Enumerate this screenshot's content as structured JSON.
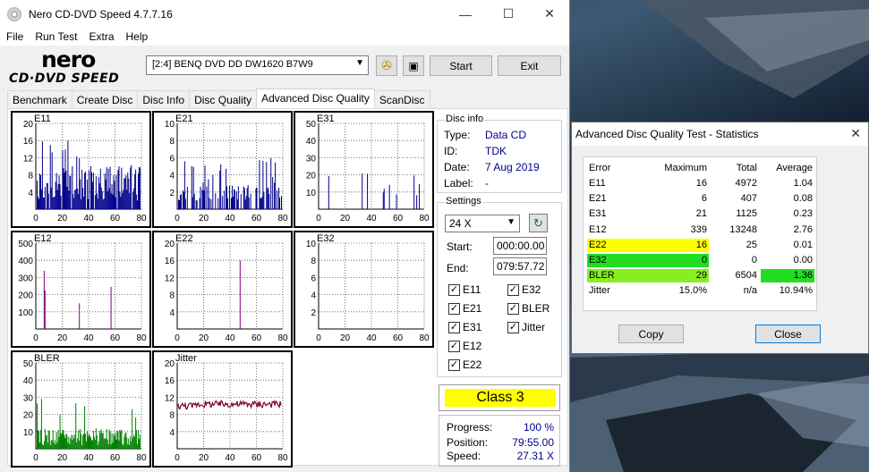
{
  "window": {
    "title": "Nero CD-DVD Speed 4.7.7.16",
    "minimize": "—",
    "maximize": "☐",
    "close": "✕"
  },
  "menu": [
    "File",
    "Run Test",
    "Extra",
    "Help"
  ],
  "logo": {
    "top": "nero",
    "bottom": "CD·DVD SPEED"
  },
  "toolbar": {
    "drive": "[2:4]   BENQ DVD DD DW1620 B7W9",
    "start": "Start",
    "exit": "Exit"
  },
  "tabs": [
    "Benchmark",
    "Create Disc",
    "Disc Info",
    "Disc Quality",
    "Advanced Disc Quality",
    "ScanDisc"
  ],
  "active_tab": 4,
  "graphs": [
    {
      "name": "E11",
      "yticks": [
        "20",
        "16",
        "12",
        "8",
        "4"
      ],
      "ymax": 20,
      "color": "#00008b",
      "kind": "bar"
    },
    {
      "name": "E21",
      "yticks": [
        "10",
        "8",
        "6",
        "4",
        "2"
      ],
      "ymax": 10,
      "color": "#00008b",
      "kind": "bar"
    },
    {
      "name": "E31",
      "yticks": [
        "50",
        "40",
        "30",
        "20",
        "10"
      ],
      "ymax": 50,
      "color": "#00008b",
      "kind": "bar"
    },
    {
      "name": "E12",
      "yticks": [
        "500",
        "400",
        "300",
        "200",
        "100"
      ],
      "ymax": 500,
      "color": "#800080",
      "kind": "bar"
    },
    {
      "name": "E22",
      "yticks": [
        "20",
        "16",
        "12",
        "8",
        "4"
      ],
      "ymax": 20,
      "color": "#800080",
      "kind": "bar"
    },
    {
      "name": "E32",
      "yticks": [
        "10",
        "8",
        "6",
        "4",
        "2"
      ],
      "ymax": 10,
      "color": "#800080",
      "kind": "bar"
    },
    {
      "name": "BLER",
      "yticks": [
        "50",
        "40",
        "30",
        "20",
        "10"
      ],
      "ymax": 50,
      "color": "#008000",
      "kind": "bar"
    },
    {
      "name": "Jitter",
      "yticks": [
        "20",
        "16",
        "12",
        "8",
        "4"
      ],
      "ymax": 20,
      "color": "#800020",
      "kind": "line"
    }
  ],
  "xticks": [
    "0",
    "20",
    "40",
    "60",
    "80"
  ],
  "disc_info": {
    "title": "Disc info",
    "rows": [
      {
        "k": "Type:",
        "v": "Data CD"
      },
      {
        "k": "ID:",
        "v": "TDK"
      },
      {
        "k": "Date:",
        "v": "7 Aug 2019"
      },
      {
        "k": "Label:",
        "v": "-"
      }
    ]
  },
  "settings": {
    "title": "Settings",
    "speed": "24 X",
    "start_label": "Start:",
    "start": "000:00.00",
    "end_label": "End:",
    "end": "079:57.72",
    "checks": [
      {
        "label": "E11",
        "checked": true
      },
      {
        "label": "E32",
        "checked": true
      },
      {
        "label": "E21",
        "checked": true
      },
      {
        "label": "BLER",
        "checked": true
      },
      {
        "label": "E31",
        "checked": true
      },
      {
        "label": "Jitter",
        "checked": true
      },
      {
        "label": "E12",
        "checked": true
      },
      {
        "label": "E22",
        "checked": true
      }
    ]
  },
  "class_label": "Class 3",
  "progress": [
    {
      "k": "Progress:",
      "v": "100 %"
    },
    {
      "k": "Position:",
      "v": "79:55.00"
    },
    {
      "k": "Speed:",
      "v": "27.31 X"
    }
  ],
  "stats": {
    "title": "Advanced Disc Quality Test - Statistics",
    "close": "✕",
    "headers": [
      "Error",
      "Maximum",
      "Total",
      "Average"
    ],
    "rows": [
      {
        "error": "E11",
        "max": "16",
        "total": "4972",
        "avg": "1.04",
        "hl_err": "",
        "hl_avg": ""
      },
      {
        "error": "E21",
        "max": "6",
        "total": "407",
        "avg": "0.08",
        "hl_err": "",
        "hl_avg": ""
      },
      {
        "error": "E31",
        "max": "21",
        "total": "1125",
        "avg": "0.23",
        "hl_err": "",
        "hl_avg": ""
      },
      {
        "error": "E12",
        "max": "339",
        "total": "13248",
        "avg": "2.76",
        "hl_err": "",
        "hl_avg": ""
      },
      {
        "error": "E22",
        "max": "16",
        "total": "25",
        "avg": "0.01",
        "hl_err": "#ffff00",
        "hl_avg": ""
      },
      {
        "error": "E32",
        "max": "0",
        "total": "0",
        "avg": "0.00",
        "hl_err": "#22dd22",
        "hl_avg": ""
      },
      {
        "error": "BLER",
        "max": "29",
        "total": "6504",
        "avg": "1.36",
        "hl_err": "#88ee22",
        "hl_avg": "#22dd22"
      },
      {
        "error": "Jitter",
        "max": "15.0%",
        "total": "n/a",
        "avg": "10.94%",
        "hl_err": "",
        "hl_avg": ""
      }
    ],
    "copy": "Copy",
    "close_btn": "Close"
  }
}
